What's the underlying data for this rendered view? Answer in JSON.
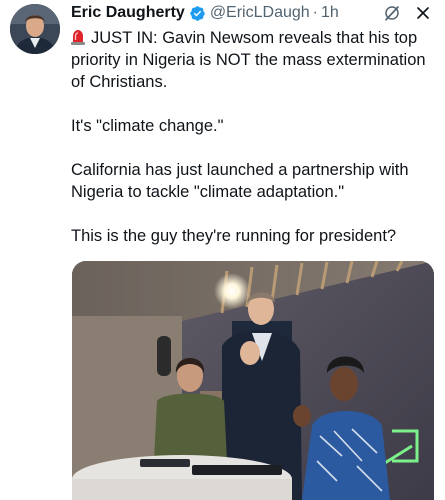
{
  "author": {
    "name": "Eric Daugherty",
    "handle": "@EricLDaugh",
    "separator": "·",
    "time": "1h"
  },
  "tweet": {
    "line1": "JUST IN: Gavin Newsom reveals that his top priority in Nigeria is NOT the mass extermination of Christians.",
    "line2": "It's \"climate change.\"",
    "line3": "California has just launched a partnership with Nigeria to tackle \"climate adaptation.\"",
    "line4": "This is the guy they're running for president?"
  },
  "icons": {
    "verified": "verified-badge-icon",
    "siren": "siren-emoji-icon",
    "grok": "grok-icon",
    "close": "close-icon"
  },
  "colors": {
    "verified_blue": "#1d9bf0",
    "text": "#0f1419",
    "muted": "#536471"
  }
}
